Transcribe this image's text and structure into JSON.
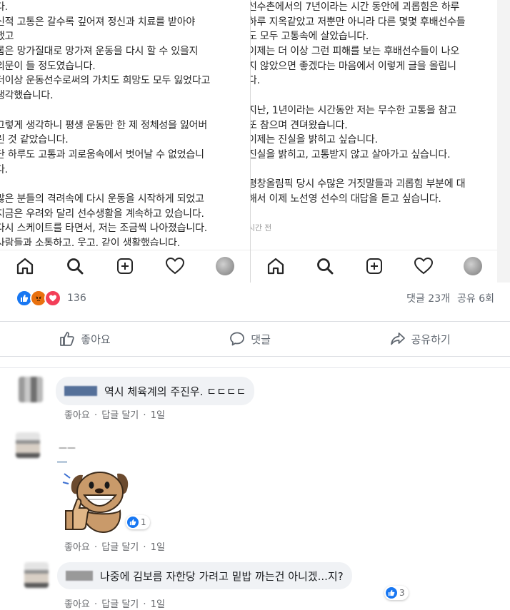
{
  "left_post": {
    "lines": [
      "다.",
      "신적 고통은 갈수록 깊어져 정신과 치료를 받아야",
      "했고",
      "롬은 망가질대로 망가져 운동을 다시 할 수 있을지",
      "의문이 들 정도였습니다.",
      "더이상 운동선수로써의 가치도 희망도 모두 잃었다고",
      "생각했습니다.",
      "",
      "그렇게 생각하니 평생 운동만 한 제 정체성을 잃어버",
      "린 것 같았습니다.",
      "단 하루도 고통과 괴로움속에서 벗어날 수 없었습니",
      "다.",
      "",
      "많은 분들의 격려속에 다시 운동을 시작하게 되었고",
      "지금은 우려와 달리 선수생활을 계속하고 있습니다.",
      "다시 스케이트를 타면서, 저는 조금씩 나아졌습니다.",
      "사람들과 소통하고, 웃고, 같이 생활했습니다."
    ]
  },
  "right_post": {
    "lines": [
      "선수촌에서의 7년이라는 시간 동안에 괴롭힘은 하루",
      "하루 지옥같았고 저뿐만 아니라 다른 몇몇 후배선수들",
      "도 모두 고통속에 살았습니다.",
      "이제는 더 이상 그런 피해를 보는 후배선수들이 나오",
      "지 않았으면 좋겠다는 마음에서 이렇게 글을 올립니",
      "다.",
      "",
      "지난, 1년이라는 시간동안 저는 무수한 고통을 참고",
      "또 참으며 견뎌왔습니다.",
      "이제는 진실을 밝히고 싶습니다.",
      "진실을 밝히고, 고통받지 않고 살아가고 싶습니다.",
      "",
      "평창올림픽 당시 수많은 거짓말들과 괴롭힘 부분에 대",
      "해서 이제 노선영 선수의 대답을 듣고 싶습니다.",
      "",
      "시간 전"
    ]
  },
  "ig_nav_icons": [
    "home-icon",
    "search-icon",
    "add-post-icon",
    "heart-icon",
    "profile-avatar"
  ],
  "stats": {
    "reaction_icons": [
      "like",
      "angry",
      "love"
    ],
    "reaction_count": "136",
    "comments": "댓글 23개",
    "shares": "공유 6회"
  },
  "actions": {
    "like": "좋아요",
    "comment": "댓글",
    "share": "공유하기"
  },
  "comments": [
    {
      "text": "역시 체육계의 주진우. ㄷㄷㄷㄷ",
      "like_label": "좋아요",
      "reply_label": "답글 달기",
      "time": "1일"
    },
    {
      "name_fragment": "ㅡㅡ",
      "sticker": "grinning-dog-thumbs-up",
      "like_count": "1",
      "like_label": "좋아요",
      "reply_label": "답글 달기",
      "time": "1일"
    },
    {
      "text": "나중에 김보름 자한당 가려고 밑밥 까는건 아니겠...지?",
      "like_count": "3",
      "like_label": "좋아요",
      "reply_label": "답글 달기",
      "time": "1일"
    }
  ],
  "meta_separator": " · ",
  "colors": {
    "facebook_blue": "#1877f2",
    "angry_orange": "#e9710f",
    "love_red": "#f33e58",
    "bubble_gray": "#f0f2f5",
    "meta_gray": "#65676b"
  }
}
